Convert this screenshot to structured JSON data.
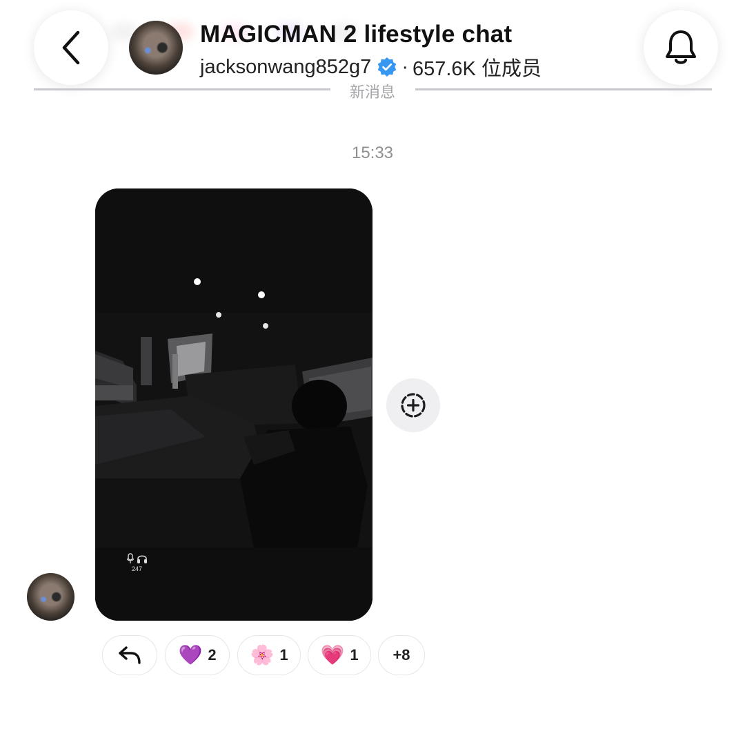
{
  "header": {
    "title": "MAGICMAN 2 lifestyle chat",
    "owner": "jacksonwang852g7",
    "separator": "·",
    "members": "657.6K 位成员",
    "new_messages": "新消息"
  },
  "icons": {
    "back": "chevron-left-icon",
    "bell": "bell-icon",
    "verified": "verified-badge-icon",
    "add_reaction": "add-reaction-icon",
    "reply": "reply-arrow-icon"
  },
  "colors": {
    "verified": "#3897f0",
    "photo_bg": "#0e0e0f",
    "pill_border": "#e6e6ea",
    "muted_text": "#8e8e93"
  },
  "message": {
    "time": "15:33",
    "photo_overlay_count": "247"
  },
  "reactions": [
    {
      "emoji": "💜",
      "count": "2"
    },
    {
      "emoji": "🌸",
      "count": "1"
    },
    {
      "emoji": "💗",
      "count": "1"
    }
  ],
  "more_reactions": "+8"
}
